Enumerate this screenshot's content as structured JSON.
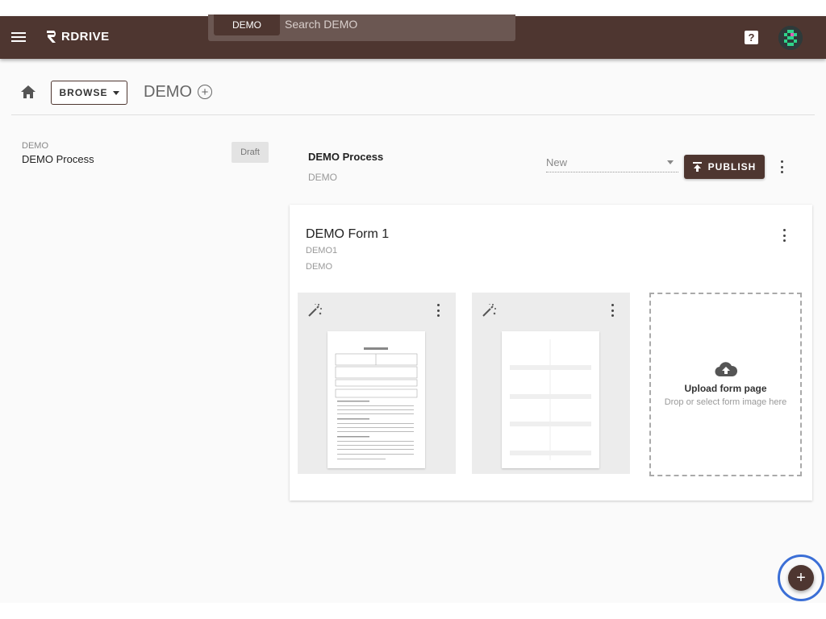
{
  "header": {
    "logo_text": "RDRIVE",
    "search_chip": "DEMO",
    "search_placeholder": "Search DEMO",
    "help_glyph": "?"
  },
  "breadcrumb": {
    "browse_label": "BROWSE",
    "title": "DEMO",
    "add_glyph": "+"
  },
  "left_list": {
    "items": [
      {
        "sub": "DEMO",
        "name": "DEMO Process",
        "badge": "Draft"
      }
    ]
  },
  "process": {
    "title": "DEMO Process",
    "subtitle": "DEMO",
    "status_value": "New",
    "publish_label": "PUBLISH"
  },
  "form": {
    "title": "DEMO Form 1",
    "code": "DEMO1",
    "owner": "DEMO",
    "upload_title": "Upload form page",
    "upload_hint": "Drop or select form image here"
  },
  "fab": {
    "glyph": "+"
  },
  "colors": {
    "brand": "#4e3630",
    "search_bg": "#6b5752",
    "focus_ring": "#3b6fd6"
  },
  "icons": [
    "menu-icon",
    "home-icon",
    "add-circle-icon",
    "help-icon",
    "upload-icon",
    "magic-wand-icon",
    "cloud-upload-icon",
    "more-vert-icon",
    "add-icon"
  ]
}
